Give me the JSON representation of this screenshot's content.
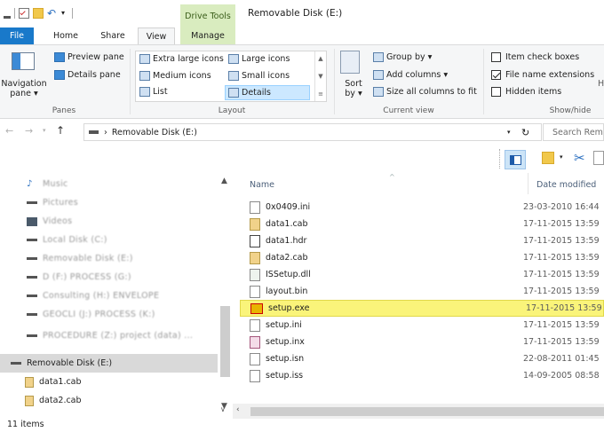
{
  "window": {
    "title": "Removable Disk (E:)",
    "context_tab": "Drive Tools",
    "quick_access": [
      "save-icon",
      "checkbox-icon",
      "folder-icon",
      "undo-icon",
      "dropdown-icon"
    ]
  },
  "tabs": [
    {
      "label": "File"
    },
    {
      "label": "Home"
    },
    {
      "label": "Share"
    },
    {
      "label": "View"
    },
    {
      "label": "Manage"
    }
  ],
  "ribbon": {
    "panes": {
      "navigation_pane": "Navigation pane ▾",
      "preview_pane": "Preview pane",
      "details_pane": "Details pane",
      "group_label": "Panes"
    },
    "layout": {
      "items": [
        "Extra large icons",
        "Large icons",
        "Medium icons",
        "Small icons",
        "List",
        "Details"
      ],
      "selected": "Details",
      "group_label": "Layout"
    },
    "current_view": {
      "sort_by": "Sort by ▾",
      "group_by": "Group by ▾",
      "add_columns": "Add columns ▾",
      "size_all_columns": "Size all columns to fit",
      "group_label": "Current view"
    },
    "show_hide": {
      "item_check_boxes": {
        "label": "Item check boxes",
        "checked": false
      },
      "file_name_extensions": {
        "label": "File name extensions",
        "checked": true
      },
      "hidden_items": {
        "label": "Hidden items",
        "checked": false
      },
      "cut_label": "H",
      "group_label": "Show/hide"
    }
  },
  "address": {
    "path_sep": "›",
    "path": "Removable Disk (E:)",
    "search_placeholder": "Search Remo"
  },
  "nav": {
    "blurred_items": [
      "Music",
      "Pictures",
      "Videos",
      "Local Disk (C:)",
      "Removable Disk (E:)",
      "D (F:) PROCESS (G:)",
      "Consulting (H:) ENVELOPE",
      "GEOCLI (J:) PROCESS (K:)",
      "PROCEDURE (Z:) project (data) ..."
    ],
    "selected_item": "Removable Disk (E:)",
    "children": [
      "data1.cab",
      "data2.cab"
    ]
  },
  "files": {
    "columns": {
      "name": "Name",
      "date": "Date modified"
    },
    "rows": [
      {
        "name": "0x0409.ini",
        "date": "23-03-2010 16:44"
      },
      {
        "name": "data1.cab",
        "date": "17-11-2015 13:59"
      },
      {
        "name": "data1.hdr",
        "date": "17-11-2015 13:59"
      },
      {
        "name": "data2.cab",
        "date": "17-11-2015 13:59"
      },
      {
        "name": "ISSetup.dll",
        "date": "17-11-2015 13:59"
      },
      {
        "name": "layout.bin",
        "date": "17-11-2015 13:59"
      },
      {
        "name": "setup.exe",
        "date": "17-11-2015 13:59"
      },
      {
        "name": "setup.ini",
        "date": "17-11-2015 13:59"
      },
      {
        "name": "setup.inx",
        "date": "17-11-2015 13:59"
      },
      {
        "name": "setup.isn",
        "date": "22-08-2011 01:45"
      },
      {
        "name": "setup.iss",
        "date": "14-09-2005 08:58"
      }
    ],
    "selected": "setup.exe"
  },
  "status": {
    "items": "11 items"
  },
  "colors": {
    "file_tab": "#1979ca",
    "context_tab": "#d9ecbf",
    "selection": "#faf47a",
    "nav_selected": "#d9d9d9"
  }
}
